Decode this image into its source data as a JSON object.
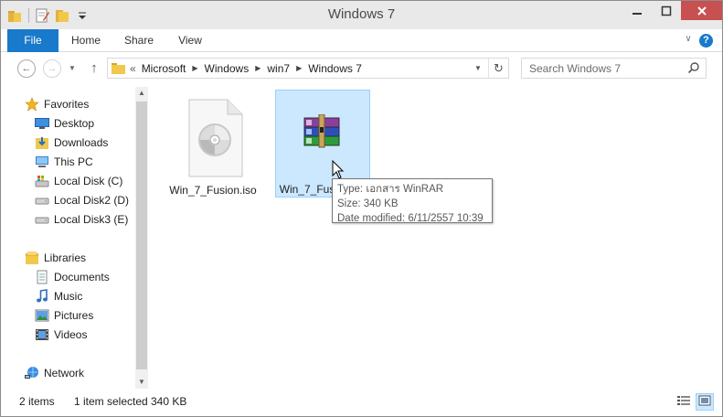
{
  "window": {
    "title": "Windows 7"
  },
  "ribbon": {
    "tabs": [
      {
        "label": "File"
      },
      {
        "label": "Home"
      },
      {
        "label": "Share"
      },
      {
        "label": "View"
      }
    ]
  },
  "address": {
    "lead": "«",
    "crumbs": [
      {
        "label": "Microsoft"
      },
      {
        "label": "Windows"
      },
      {
        "label": "win7"
      },
      {
        "label": "Windows 7"
      }
    ]
  },
  "search": {
    "placeholder": "Search Windows 7"
  },
  "nav_pane": {
    "items": [
      {
        "label": "Favorites",
        "icon": "star-icon"
      },
      {
        "label": "Desktop",
        "icon": "desktop-icon"
      },
      {
        "label": "Downloads",
        "icon": "downloads-icon"
      },
      {
        "label": "This PC",
        "icon": "computer-icon"
      },
      {
        "label": "Local Disk (C)",
        "icon": "drive-windows-icon"
      },
      {
        "label": "Local Disk2 (D)",
        "icon": "drive-icon"
      },
      {
        "label": "Local Disk3 (E)",
        "icon": "drive-icon"
      },
      {
        "label": "Libraries",
        "icon": "libraries-icon"
      },
      {
        "label": "Documents",
        "icon": "documents-icon"
      },
      {
        "label": "Music",
        "icon": "music-icon"
      },
      {
        "label": "Pictures",
        "icon": "pictures-icon"
      },
      {
        "label": "Videos",
        "icon": "videos-icon"
      },
      {
        "label": "Network",
        "icon": "network-icon"
      }
    ]
  },
  "files": [
    {
      "name": "Win_7_Fusion.iso",
      "icon": "disc-image-icon",
      "selected": false
    },
    {
      "name": "Win_7_Fusion.rar",
      "icon": "winrar-archive-icon",
      "selected": true
    }
  ],
  "tooltip": {
    "type": "Type: เอกสาร WinRAR",
    "size": "Size: 340 KB",
    "modified": "Date modified: 6/11/2557 10:39"
  },
  "status": {
    "count": "2 items",
    "selection": "1 item selected",
    "size": "340 KB"
  },
  "colors": {
    "accent": "#1979ca",
    "selection": "#cce8ff",
    "selection_border": "#99d1ff",
    "close": "#c75050"
  }
}
